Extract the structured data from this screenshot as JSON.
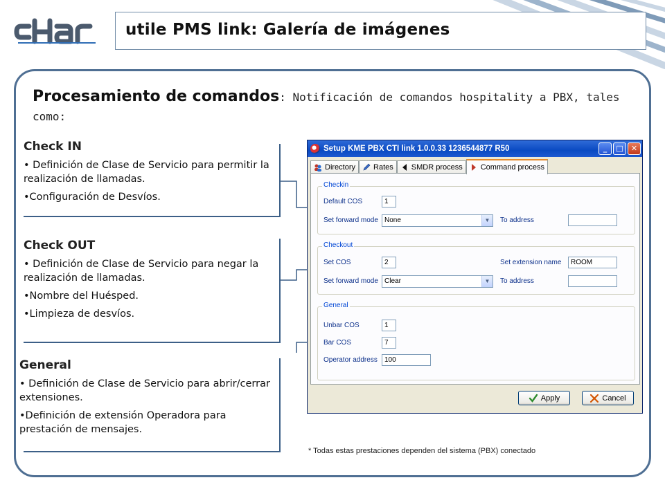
{
  "header": {
    "logo_text": "cHar",
    "title": "utile PMS link: Galería de imágenes"
  },
  "heading": {
    "bold": "Procesamiento de comandos",
    "rest": ": Notificación de comandos hospitality a PBX, tales como:"
  },
  "sections": [
    {
      "title": "Check IN",
      "items": [
        "• Definición de Clase de Servicio para permitir la realización de llamadas.",
        "•Configuración de Desvíos."
      ]
    },
    {
      "title": "Check OUT",
      "items": [
        "• Definición de Clase de Servicio para negar la realización de llamadas.",
        "•Nombre del Huésped.",
        "•Limpieza de desvíos."
      ]
    },
    {
      "title": "General",
      "items": [
        "• Definición de Clase de Servicio para abrir/cerrar extensiones.",
        "•Definición de extensión Operadora para prestación de mensajes."
      ]
    }
  ],
  "dialog": {
    "title": "Setup KME PBX CTI link 1.0.0.33  1236544877 R50",
    "window_buttons": {
      "minimize": "_",
      "maximize": "□",
      "close": "✕"
    },
    "tabs": [
      {
        "label": "Directory",
        "icon": "people-icon",
        "active": false
      },
      {
        "label": "Rates",
        "icon": "pencil-icon",
        "active": false
      },
      {
        "label": "SMDR process",
        "icon": "arrow-left-icon",
        "active": false
      },
      {
        "label": "Command process",
        "icon": "arrow-right-icon",
        "active": true
      }
    ],
    "checkin": {
      "label": "Checkin",
      "default_cos_label": "Default COS",
      "default_cos_value": "1",
      "forward_mode_label": "Set forward mode",
      "forward_mode_value": "None",
      "to_address_label": "To address",
      "to_address_value": ""
    },
    "checkout": {
      "label": "Checkout",
      "set_cos_label": "Set COS",
      "set_cos_value": "2",
      "extension_name_label": "Set extension name",
      "extension_name_value": "ROOM",
      "forward_mode_label": "Set forward mode",
      "forward_mode_value": "Clear",
      "to_address_label": "To address",
      "to_address_value": ""
    },
    "general": {
      "label": "General",
      "unbar_cos_label": "Unbar COS",
      "unbar_cos_value": "1",
      "bar_cos_label": "Bar COS",
      "bar_cos_value": "7",
      "operator_address_label": "Operator address",
      "operator_address_value": "100"
    },
    "apply_label": "Apply",
    "cancel_label": "Cancel"
  },
  "footnote": "* Todas estas prestaciones dependen del sistema (PBX) conectado",
  "colors": {
    "panel_border": "#4f6f93",
    "bracket": "#3c5f87",
    "xp_title": "#0a4ac2",
    "xp_group_label": "#0046d5"
  }
}
